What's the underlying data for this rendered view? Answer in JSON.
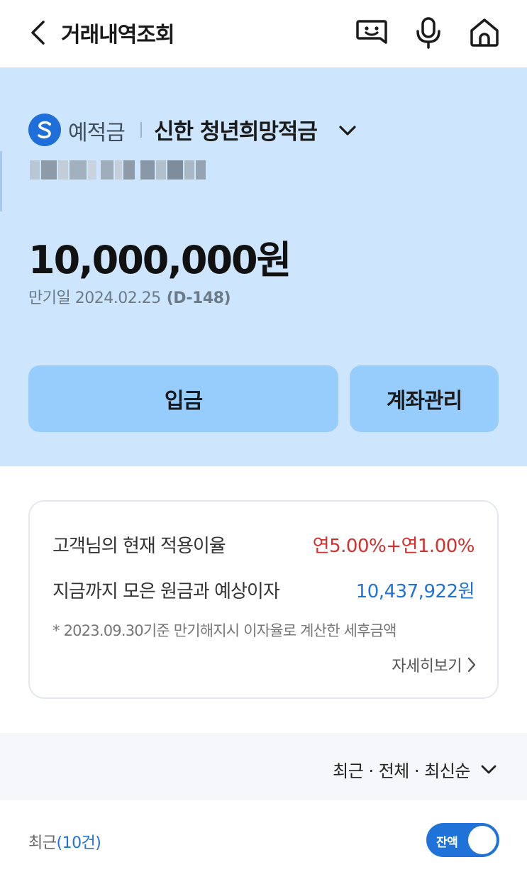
{
  "header": {
    "title": "거래내역조회",
    "icons": [
      "back-icon",
      "chatbot-icon",
      "mic-icon",
      "home-icon"
    ]
  },
  "account": {
    "type": "예적금",
    "name": "신한 청년희망적금",
    "balance": "10,000,000원",
    "maturity_label": "만기일 2024.02.25",
    "dday": "(D-148)"
  },
  "actions": {
    "deposit": "입금",
    "manage": "계좌관리"
  },
  "interest_card": {
    "rate_label": "고객님의 현재 적용이율",
    "rate_value": "연5.00%+연1.00%",
    "total_label": "지금까지 모은 원금과 예상이자",
    "total_value": "10,437,922원",
    "note": "* 2023.09.30기준 만기해지시 이자율로 계산한 세후금액",
    "detail_link": "자세히보기"
  },
  "filter": {
    "label": "최근 · 전체 · 최신순"
  },
  "list": {
    "recent_label": "최근",
    "recent_count": "(10건)",
    "balance_toggle_label": "잔액",
    "balance_toggle_on": true
  },
  "colors": {
    "hero_bg": "#cde5fd",
    "button_bg": "#97cdfd",
    "brand_blue": "#1f73d8",
    "rate_red": "#d32f2f",
    "total_blue": "#1f73d8"
  }
}
